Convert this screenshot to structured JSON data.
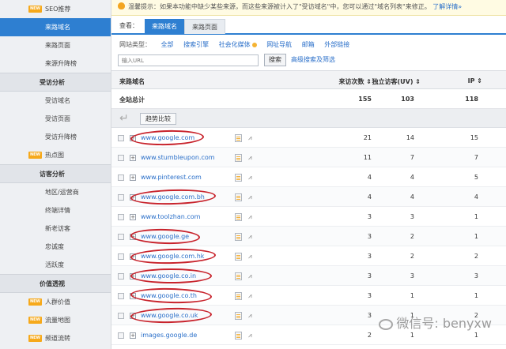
{
  "sidebar": {
    "new_tag": "NEW",
    "items_top": [
      {
        "label": "SEO推荐",
        "new": true,
        "active": false
      },
      {
        "label": "来路域名",
        "new": false,
        "active": true
      },
      {
        "label": "来路页面",
        "new": false,
        "active": false
      },
      {
        "label": "来源升降榜",
        "new": false,
        "active": false
      }
    ],
    "section_visitor": "受访分析",
    "items_visitor": [
      "受访域名",
      "受访页面",
      "受访升降榜"
    ],
    "hotmap": "热点图",
    "section_guest": "访客分析",
    "items_guest": [
      "地区/运营商",
      "终端详情",
      "新老访客",
      "忠诚度",
      "活跃度"
    ],
    "section_value": "价值透视",
    "items_value": [
      "人群价值",
      "流量地图",
      "频道流转"
    ]
  },
  "notice": {
    "text": "温馨提示：如果本功能中缺少某些来源，而这些来源被计入了\"受访域名\"中，您可以通过\"域名列表\"来修正。",
    "more": "了解详情»"
  },
  "tabs": {
    "view_label": "查看：",
    "active": "来路域名",
    "inactive": "来路页面"
  },
  "filters": {
    "label": "网站类型：",
    "items": [
      "全部",
      "搜索引擎",
      "社会化媒体",
      "网址导航",
      "邮箱",
      "外部链接"
    ]
  },
  "search": {
    "placeholder": "输入URL",
    "button": "搜索",
    "advanced": "高级搜索及筛选"
  },
  "table": {
    "headers": {
      "domain": "来路域名",
      "visits": "来访次数 ⇕",
      "uv": "独立访客(UV) ⇕",
      "ip": "IP ⇕"
    },
    "total": {
      "label": "全站总计",
      "visits": "155",
      "uv": "103",
      "ip": "118"
    },
    "compare_button": "趋势比较",
    "rows": [
      {
        "domain": "www.google.com",
        "visits": "21",
        "uv": "14",
        "ip": "15",
        "circled": true
      },
      {
        "domain": "www.stumbleupon.com",
        "visits": "11",
        "uv": "7",
        "ip": "7",
        "circled": false
      },
      {
        "domain": "www.pinterest.com",
        "visits": "4",
        "uv": "4",
        "ip": "5",
        "circled": false
      },
      {
        "domain": "www.google.com.bh",
        "visits": "4",
        "uv": "4",
        "ip": "4",
        "circled": true
      },
      {
        "domain": "www.toolzhan.com",
        "visits": "3",
        "uv": "3",
        "ip": "1",
        "circled": false
      },
      {
        "domain": "www.google.ge",
        "visits": "3",
        "uv": "2",
        "ip": "1",
        "circled": true
      },
      {
        "domain": "www.google.com.hk",
        "visits": "3",
        "uv": "2",
        "ip": "2",
        "circled": true
      },
      {
        "domain": "www.google.co.in",
        "visits": "3",
        "uv": "3",
        "ip": "3",
        "circled": true
      },
      {
        "domain": "www.google.co.th",
        "visits": "3",
        "uv": "1",
        "ip": "1",
        "circled": true
      },
      {
        "domain": "www.google.co.uk",
        "visits": "3",
        "uv": "1",
        "ip": "2",
        "circled": true
      },
      {
        "domain": "images.google.de",
        "visits": "2",
        "uv": "1",
        "ip": "1",
        "circled": false
      }
    ]
  },
  "watermark": "微信号: benyxw",
  "colors": {
    "accent": "#2e7fd1",
    "annotation": "#c8232c",
    "new_badge": "#f6a91b"
  }
}
